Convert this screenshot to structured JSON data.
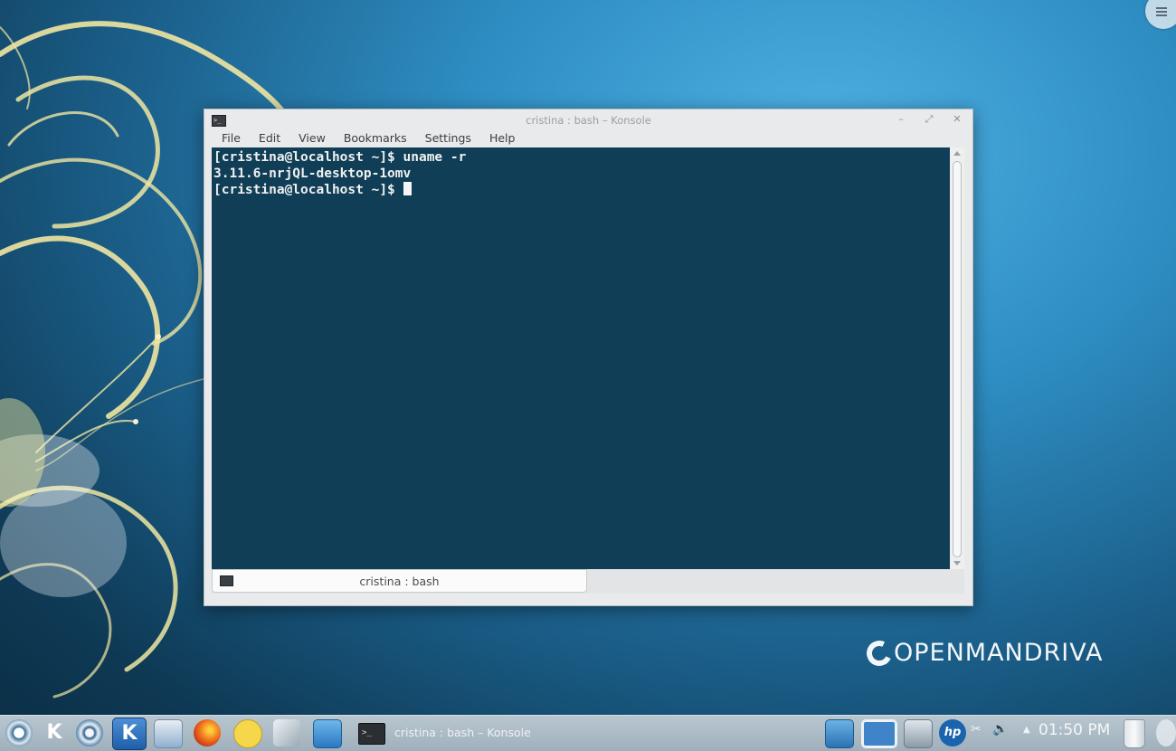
{
  "desktop": {
    "brand_text": "OPENMANDRIVA"
  },
  "window": {
    "title": "cristina : bash – Konsole",
    "buttons": {
      "minimize": "–",
      "maximize": "⤢",
      "close": "✕"
    },
    "menu": [
      "File",
      "Edit",
      "View",
      "Bookmarks",
      "Settings",
      "Help"
    ],
    "terminal_lines": [
      "[cristina@localhost ~]$ uname -r",
      "3.11.6-nrjQL-desktop-1omv",
      "[cristina@localhost ~]$ "
    ],
    "tab_label": "cristina : bash"
  },
  "taskbar": {
    "task_label": "cristina : bash – Konsole",
    "clock": "01:50 PM",
    "launchers": [
      "mandriva-menu-icon",
      "k-icon",
      "browser-swirl-icon",
      "kde-icon",
      "file-manager-icon",
      "firefox-icon",
      "chat-icon",
      "screenshot-tool-icon",
      "media-player-icon"
    ],
    "tray": [
      "camera-icon",
      "workspace-pager-icon",
      "network-manager-icon",
      "hp-printer-icon",
      "scissors-icon",
      "volume-icon",
      "tray-expander-icon",
      "trash-icon"
    ]
  },
  "colors": {
    "terminal_bg": "#0f3e56",
    "terminal_fg": "#f0f0f0",
    "taskbar": "#aebcc6",
    "wallpaper_swirl": "#efe6a1"
  }
}
